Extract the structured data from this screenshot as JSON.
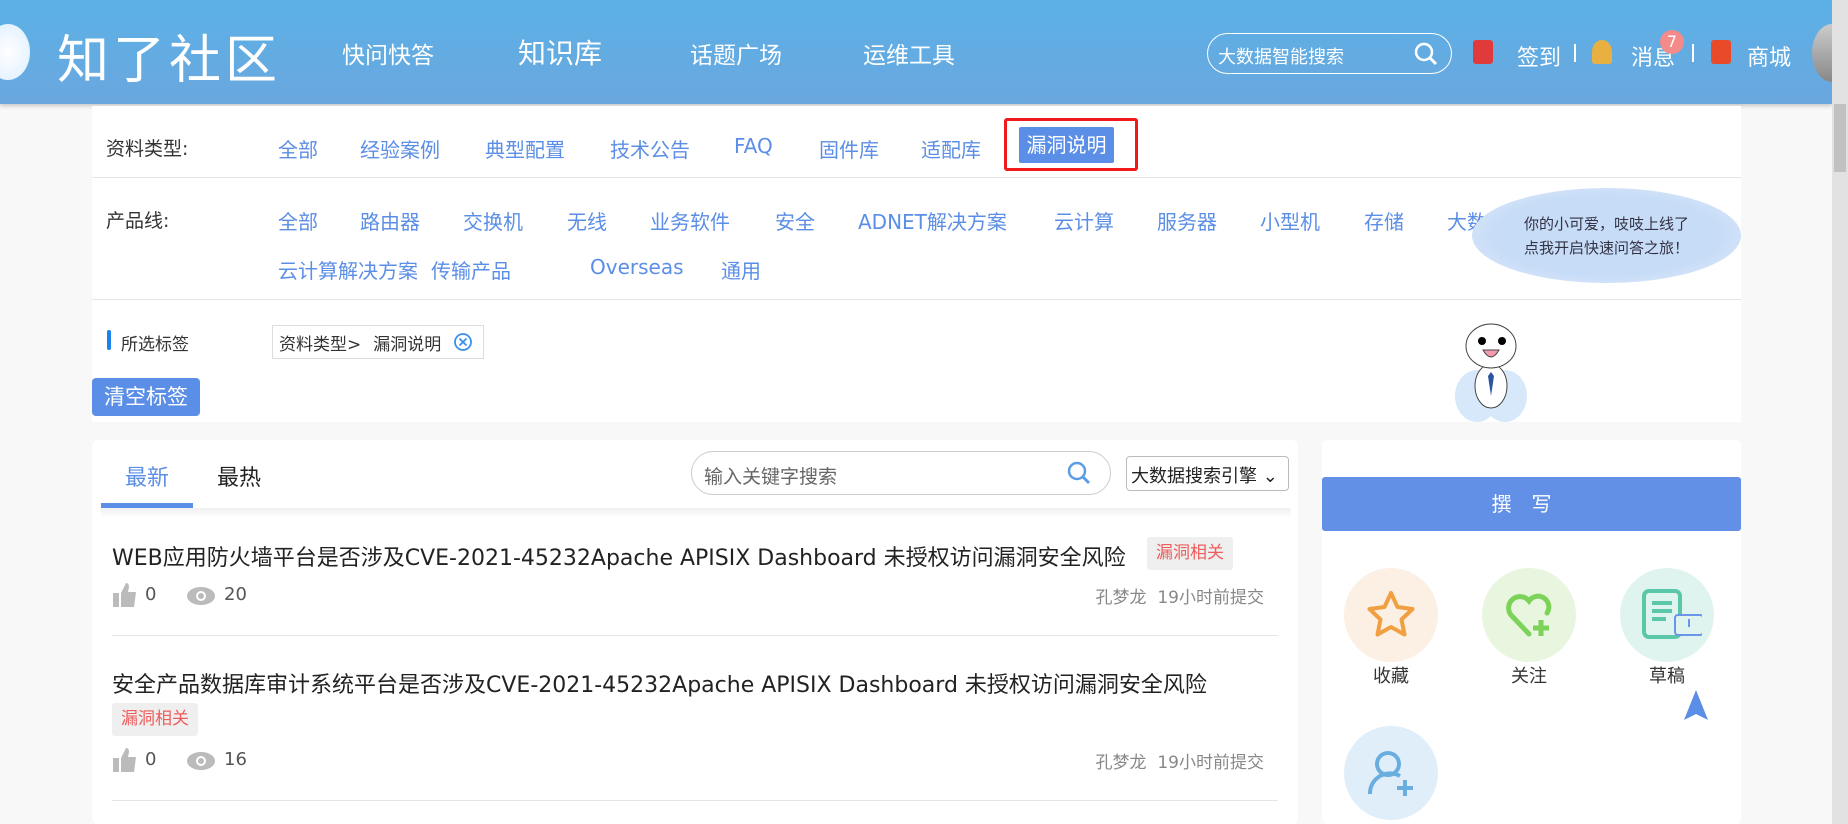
{
  "header": {
    "logo": "知了社区",
    "nav": [
      "快问快答",
      "知识库",
      "话题广场",
      "运维工具"
    ],
    "search_placeholder": "大数据智能搜索",
    "signin": "签到",
    "messages": "消息",
    "message_count": "7",
    "mall": "商城"
  },
  "filters": {
    "type_label": "资料类型:",
    "types": [
      "全部",
      "经验案例",
      "典型配置",
      "技术公告",
      "FAQ",
      "固件库",
      "适配库",
      "漏洞说明"
    ],
    "selected_type": "漏洞说明",
    "product_label": "产品线:",
    "products": [
      "全部",
      "路由器",
      "交换机",
      "无线",
      "业务软件",
      "安全",
      "ADNET解决方案",
      "云计算",
      "服务器",
      "小型机",
      "存储",
      "大数",
      "云计算解决方案",
      "传输产品",
      "Overseas",
      "通用"
    ],
    "selected_tags_label": "所选标签",
    "tag_prefix": "资料类型>",
    "tag_value": "漏洞说明",
    "clear_label": "清空标签"
  },
  "mascot": {
    "bubble_line1": "你的小可爱，吱吱上线了",
    "bubble_line2": "点我开启快速问答之旅！"
  },
  "list": {
    "tabs": [
      "最新",
      "最热"
    ],
    "active_tab": "最新",
    "search_placeholder": "输入关键字搜索",
    "engine": "大数据搜索引擎",
    "items": [
      {
        "title": "WEB应用防火墙平台是否涉及CVE-2021-45232Apache APISIX Dashboard 未授权访问漏洞安全风险",
        "tag": "漏洞相关",
        "likes": "0",
        "views": "20",
        "author": "孔梦龙",
        "time": "19小时前提交"
      },
      {
        "title": "安全产品数据库审计系统平台是否涉及CVE-2021-45232Apache APISIX Dashboard 未授权访问漏洞安全风险",
        "tag": "漏洞相关",
        "likes": "0",
        "views": "16",
        "author": "孔梦龙",
        "time": "19小时前提交"
      }
    ]
  },
  "side": {
    "write": "撰写",
    "actions": [
      {
        "label": "收藏",
        "icon": "star-icon",
        "color": "#f0a040"
      },
      {
        "label": "关注",
        "icon": "heart-plus-icon",
        "color": "#7dd35a"
      },
      {
        "label": "草稿",
        "icon": "draft-icon",
        "color": "#5ac8a8"
      },
      {
        "label": "",
        "icon": "add-user-icon",
        "color": "#6aaee0"
      }
    ]
  },
  "colors": {
    "accent": "#5b8ee6",
    "header": "#5bb1e6",
    "highlight": "#f01a1a",
    "tag_text": "#ef5c5c"
  }
}
